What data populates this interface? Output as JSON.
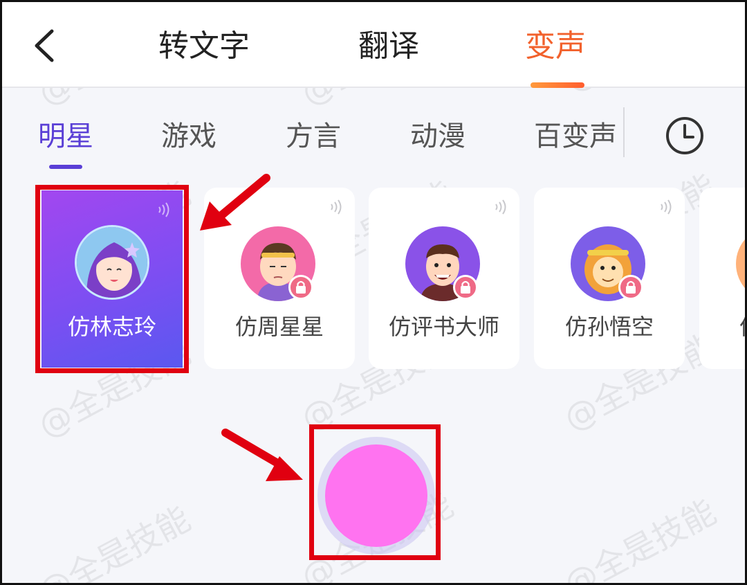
{
  "header": {
    "tabs": [
      {
        "label": "转文字",
        "active": false
      },
      {
        "label": "翻译",
        "active": false
      },
      {
        "label": "变声",
        "active": true
      }
    ]
  },
  "categories": {
    "items": [
      "明星",
      "游戏",
      "方言",
      "动漫",
      "百变声"
    ],
    "active_index": 0
  },
  "voices": [
    {
      "label": "仿林志玲",
      "selected": true,
      "locked": false
    },
    {
      "label": "仿周星星",
      "selected": false,
      "locked": true
    },
    {
      "label": "仿评书大师",
      "selected": false,
      "locked": true
    },
    {
      "label": "仿孙悟空",
      "selected": false,
      "locked": true
    },
    {
      "label": "仿",
      "selected": false,
      "locked": false
    }
  ],
  "watermark": "@全是技能",
  "colors": {
    "accent_orange": "#f2612c",
    "accent_purple": "#5a3fd6",
    "record_button": "#ff73f0",
    "highlight_red": "#e00010"
  }
}
